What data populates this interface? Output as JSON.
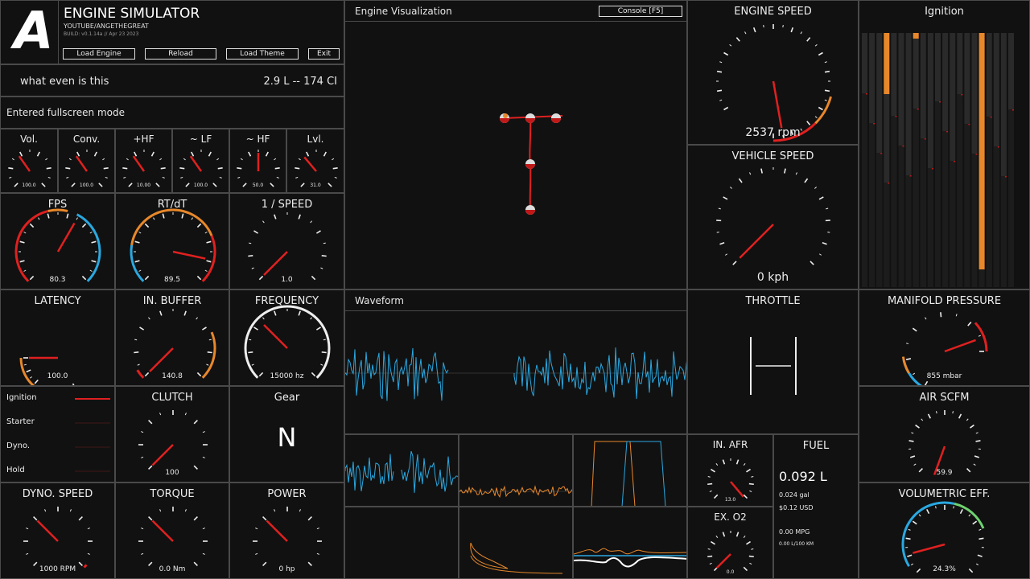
{
  "app": {
    "logo": "A",
    "title": "ENGINE SIMULATOR",
    "subtitle": "YOUTUBE/ANGETHEGREAT",
    "build": "BUILD: v0.1.14a // Apr 23 2023",
    "buttons": [
      "Load Engine",
      "Reload",
      "Load Theme",
      "Exit"
    ]
  },
  "engine_info": {
    "name": "what even is this",
    "displacement": "2.9 L -- 174 CI"
  },
  "status_message": "Entered fullscreen mode",
  "audio_gauges": [
    {
      "label": "Vol.",
      "value": "100.0"
    },
    {
      "label": "Conv.",
      "value": "100.0"
    },
    {
      "label": "+HF",
      "value": "10.00"
    },
    {
      "label": "~ LF",
      "value": "100.0"
    },
    {
      "label": "~ HF",
      "value": "50.0"
    },
    {
      "label": "Lvl.",
      "value": "31.0"
    }
  ],
  "perf_gauges": [
    {
      "label": "FPS",
      "value": "80.3"
    },
    {
      "label": "RT/dT",
      "value": "89.5"
    },
    {
      "label": "1 / SPEED",
      "value": "1.0"
    },
    {
      "label": "LATENCY",
      "value": "100.0"
    },
    {
      "label": "IN. BUFFER",
      "value": "140.8"
    },
    {
      "label": "FREQUENCY",
      "value": "15000 hz"
    }
  ],
  "lamps": [
    {
      "label": "Ignition",
      "active": true
    },
    {
      "label": "Starter",
      "active": false
    },
    {
      "label": "Dyno.",
      "active": false
    },
    {
      "label": "Hold",
      "active": false
    }
  ],
  "clutch": {
    "label": "CLUTCH",
    "value": "100"
  },
  "gear": {
    "label": "Gear",
    "value": "N"
  },
  "dyno": [
    {
      "label": "DYNO. SPEED",
      "value": "1000 RPM"
    },
    {
      "label": "TORQUE",
      "value": "0.0 Nm"
    },
    {
      "label": "POWER",
      "value": "0 hp"
    }
  ],
  "visualization": {
    "title": "Engine Visualization",
    "console_button": "Console [F5]"
  },
  "waveform": {
    "title": "Waveform"
  },
  "engine_speed": {
    "label": "ENGINE SPEED",
    "value": "2537 rpm"
  },
  "vehicle_speed": {
    "label": "VEHICLE SPEED",
    "value": "0 kph"
  },
  "ignition": {
    "title": "Ignition"
  },
  "throttle": {
    "label": "THROTTLE"
  },
  "manifold_pressure": {
    "label": "MANIFOLD PRESSURE",
    "value": "855 mbar"
  },
  "air_scfm": {
    "label": "AIR SCFM",
    "value": "59.9"
  },
  "volumetric_eff": {
    "label": "VOLUMETRIC EFF.",
    "value": "24.3%"
  },
  "in_afr": {
    "label": "IN. AFR",
    "value": "13.0"
  },
  "ex_o2": {
    "label": "EX. O2",
    "value": "0.0"
  },
  "fuel": {
    "label": "FUEL",
    "liters": "0.092 L",
    "gallons": "0.024 gal",
    "cost": "$0.12 USD",
    "mpg": "0.00 MPG",
    "l100": "0.00 L/100 KM"
  },
  "colors": {
    "needle": "#e02020",
    "orange": "#e8882a",
    "blue": "#2aa8e0",
    "green": "#6fd36f",
    "border": "#4a4a4a"
  }
}
